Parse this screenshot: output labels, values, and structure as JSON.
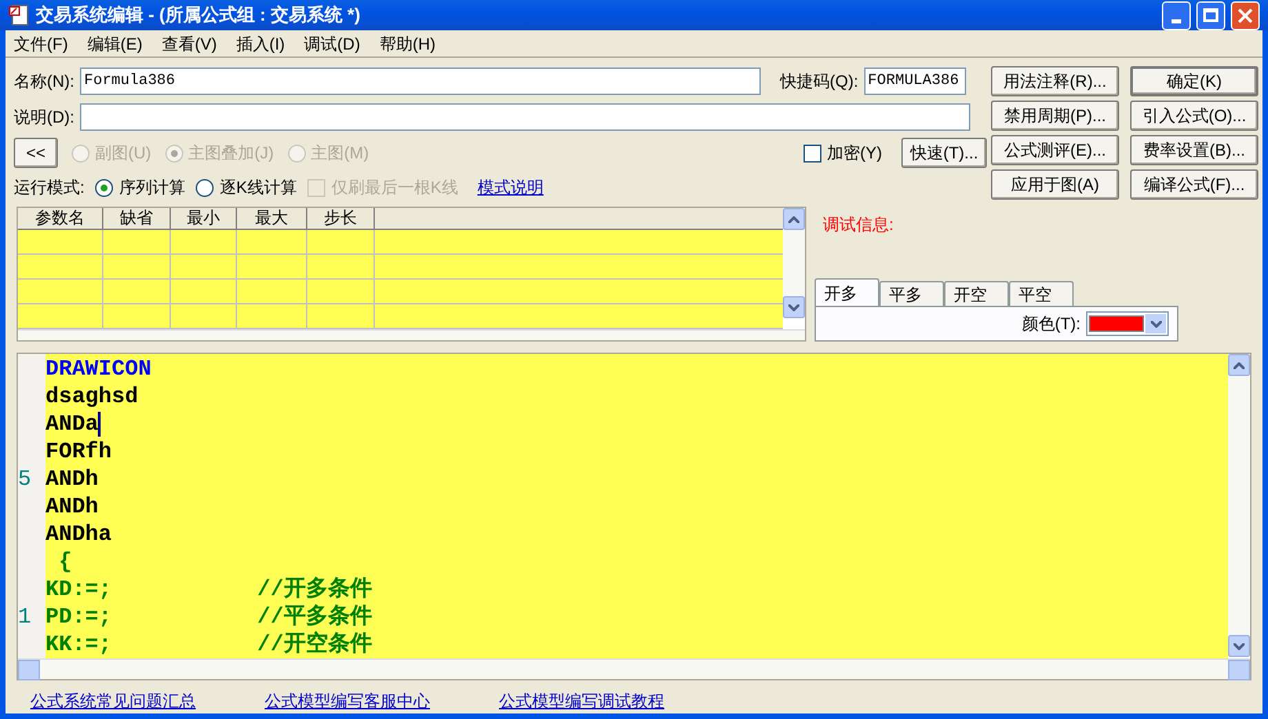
{
  "window": {
    "title": "交易系统编辑 - (所属公式组 : 交易系统 *)"
  },
  "menu": [
    "文件(F)",
    "编辑(E)",
    "查看(V)",
    "插入(I)",
    "调试(D)",
    "帮助(H)"
  ],
  "name_field": {
    "label": "名称(N):",
    "value": "Formula386"
  },
  "shortcut_field": {
    "label": "快捷码(Q):",
    "value": "FORMULA386"
  },
  "desc_field": {
    "label": "说明(D):"
  },
  "collapse_button": "<<",
  "chart_radios": [
    {
      "label": "副图(U)",
      "selected": false,
      "disabled": true
    },
    {
      "label": "主图叠加(J)",
      "selected": true,
      "disabled": true
    },
    {
      "label": "主图(M)",
      "selected": false,
      "disabled": true
    }
  ],
  "encrypt": {
    "label": "加密(Y)",
    "checked": false
  },
  "quick_button": "快速(T)...",
  "run_mode": {
    "label": "运行模式:",
    "options": [
      {
        "label": "序列计算",
        "selected": true
      },
      {
        "label": "逐K线计算",
        "selected": false
      }
    ],
    "last_bar_only": {
      "label": "仅刷最后一根K线",
      "checked": false,
      "disabled": true
    },
    "help_link": "模式说明"
  },
  "buttons": [
    "用法注释(R)...",
    "确定(K)",
    "禁用周期(P)...",
    "引入公式(O)...",
    "公式测评(E)...",
    "费率设置(B)...",
    "应用于图(A)",
    "编译公式(F)..."
  ],
  "params_table": {
    "columns": [
      "参数名",
      "缺省",
      "最小",
      "最大",
      "步长"
    ]
  },
  "debug": {
    "label": "调试信息:"
  },
  "signal_tabs": [
    {
      "label": "开多",
      "selected": true
    },
    {
      "label": "平多",
      "selected": false
    },
    {
      "label": "开空",
      "selected": false
    },
    {
      "label": "平空",
      "selected": false
    }
  ],
  "color_field": {
    "label": "颜色(T):",
    "color": "#ff0000"
  },
  "editor": {
    "lines": [
      {
        "text": "DRAWICON",
        "kind": "keyword",
        "caret": false
      },
      {
        "text": "dsaghsd",
        "kind": "plain",
        "caret": false
      },
      {
        "text": "ANDa",
        "kind": "plain",
        "caret": true
      },
      {
        "text": "FORfh",
        "kind": "plain",
        "caret": false
      },
      {
        "text": "ANDh",
        "kind": "plain",
        "number": "5",
        "caret": false
      },
      {
        "text": "ANDh",
        "kind": "plain",
        "caret": false
      },
      {
        "text": "ANDha",
        "kind": "plain",
        "caret": false
      },
      {
        "text": " {",
        "kind": "code",
        "caret": false
      },
      {
        "text": "KD:=;           //开多条件",
        "kind": "code",
        "caret": false
      },
      {
        "text": "PD:=;           //平多条件",
        "kind": "code",
        "number": "1",
        "caret": false
      },
      {
        "text": "KK:=;           //开空条件",
        "kind": "code",
        "caret": false
      }
    ]
  },
  "footer_links": [
    "公式系统常见问题汇总",
    "公式模型编写客服中心",
    "公式模型编写调试教程"
  ]
}
